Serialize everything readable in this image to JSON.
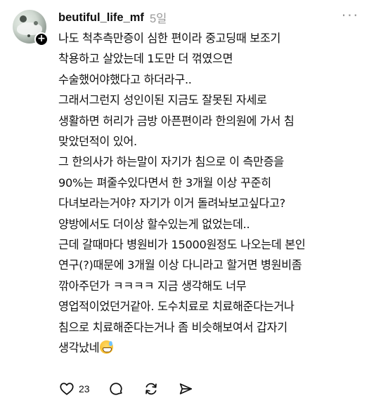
{
  "post": {
    "username": "beutiful_life_mf",
    "time": "5일",
    "more_icon": "more-horizontal-icon",
    "avatar_badge": "+",
    "lines": [
      "나도 척추측만증이 심한 편이라 중고딩때 보조기",
      "착용하고 살았는데 1도만 더 꺾였으면",
      "수술했어야했다고 하더라구..",
      "그래서그런지 성인이된 지금도 잘못된 자세로",
      "생활하면 허리가 금방 아픈편이라 한의원에 가서 침",
      "맞았던적이 있어.",
      "그 한의사가 하는말이 자기가 침으로 이 측만증을",
      "90%는 펴줄수있다면서 한 3개월 이상 꾸준히",
      "다녀보라는거야? 자기가 이거 돌려놔보고싶다고?",
      "양방에서도 더이상 할수있는게 없었는데..",
      "근데 갈때마다 병원비가 15000원정도 나오는데 본인",
      "연구(?)때문에 3개월 이상 다니라고 할거면 병원비좀",
      "깎아주던가 ㅋㅋㅋㅋ 지금 생각해도 너무",
      "영업적이었던거같아. 도수치료로 치료해준다는거나",
      "침으로 치료해준다는거나 좀 비슷해보여서 갑자기",
      "생각났네"
    ],
    "emoji": "grinning-face-with-sweat"
  },
  "actions": {
    "like_count": "23",
    "icons": [
      "heart-icon",
      "comment-icon",
      "repost-icon",
      "share-icon"
    ]
  }
}
